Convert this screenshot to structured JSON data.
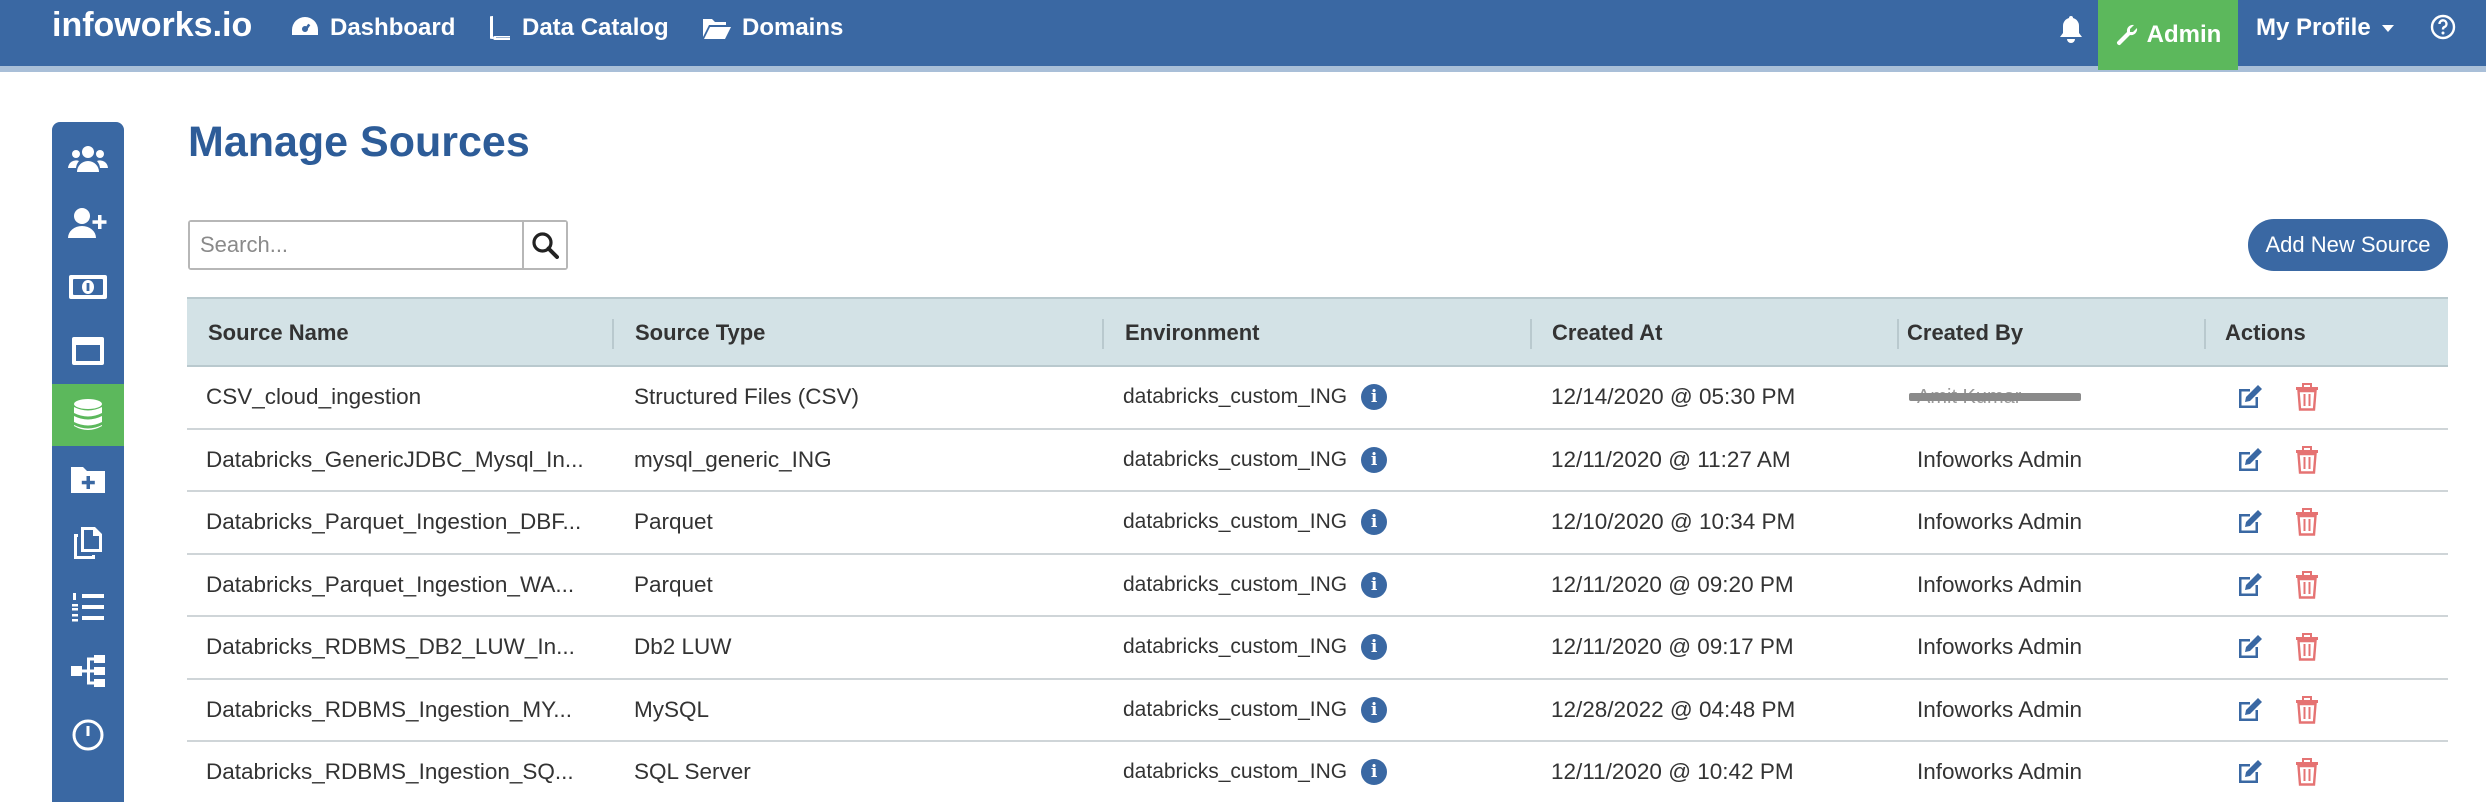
{
  "header": {
    "brand": "infoworks.io",
    "nav": [
      {
        "label": "Dashboard",
        "icon": "dashboard-icon"
      },
      {
        "label": "Data Catalog",
        "icon": "book-icon"
      },
      {
        "label": "Domains",
        "icon": "folder-open-icon"
      }
    ],
    "admin_label": "Admin",
    "profile_label": "My Profile"
  },
  "sidebar": {
    "items": [
      {
        "icon": "users-icon"
      },
      {
        "icon": "user-plus-icon"
      },
      {
        "icon": "money-icon"
      },
      {
        "icon": "window-icon"
      },
      {
        "icon": "database-icon",
        "active": true
      },
      {
        "icon": "folder-plus-icon"
      },
      {
        "icon": "copy-icon"
      },
      {
        "icon": "list-ol-icon"
      },
      {
        "icon": "sitemap-icon"
      },
      {
        "icon": "clock-icon"
      }
    ]
  },
  "page": {
    "title": "Manage Sources",
    "search_placeholder": "Search...",
    "add_button": "Add New Source"
  },
  "table": {
    "columns": [
      "Source Name",
      "Source Type",
      "Environment",
      "Created At",
      "Created By",
      "Actions"
    ],
    "rows": [
      {
        "name": "CSV_cloud_ingestion",
        "type": "Structured Files (CSV)",
        "env": "databricks_custom_ING",
        "created_at": "12/14/2020 @ 05:30 PM",
        "created_by": "Amit Kumar",
        "redacted": true
      },
      {
        "name": "Databricks_GenericJDBC_Mysql_In...",
        "type": "mysql_generic_ING",
        "env": "databricks_custom_ING",
        "created_at": "12/11/2020 @ 11:27 AM",
        "created_by": "Infoworks Admin"
      },
      {
        "name": "Databricks_Parquet_Ingestion_DBF...",
        "type": "Parquet",
        "env": "databricks_custom_ING",
        "created_at": "12/10/2020 @ 10:34 PM",
        "created_by": "Infoworks Admin"
      },
      {
        "name": "Databricks_Parquet_Ingestion_WA...",
        "type": "Parquet",
        "env": "databricks_custom_ING",
        "created_at": "12/11/2020 @ 09:20 PM",
        "created_by": "Infoworks Admin"
      },
      {
        "name": "Databricks_RDBMS_DB2_LUW_In...",
        "type": "Db2 LUW",
        "env": "databricks_custom_ING",
        "created_at": "12/11/2020 @ 09:17 PM",
        "created_by": "Infoworks Admin"
      },
      {
        "name": "Databricks_RDBMS_Ingestion_MY...",
        "type": "MySQL",
        "env": "databricks_custom_ING",
        "created_at": "12/28/2022 @ 04:48 PM",
        "created_by": "Infoworks Admin"
      },
      {
        "name": "Databricks_RDBMS_Ingestion_SQ...",
        "type": "SQL Server",
        "env": "databricks_custom_ING",
        "created_at": "12/11/2020 @ 10:42 PM",
        "created_by": "Infoworks Admin"
      }
    ]
  },
  "colors": {
    "primary": "#3a68a3",
    "active": "#5cb85c",
    "title": "#2d5c98",
    "edit": "#3a68a3",
    "delete": "#e57373",
    "table_header": "#d3e2e6"
  }
}
